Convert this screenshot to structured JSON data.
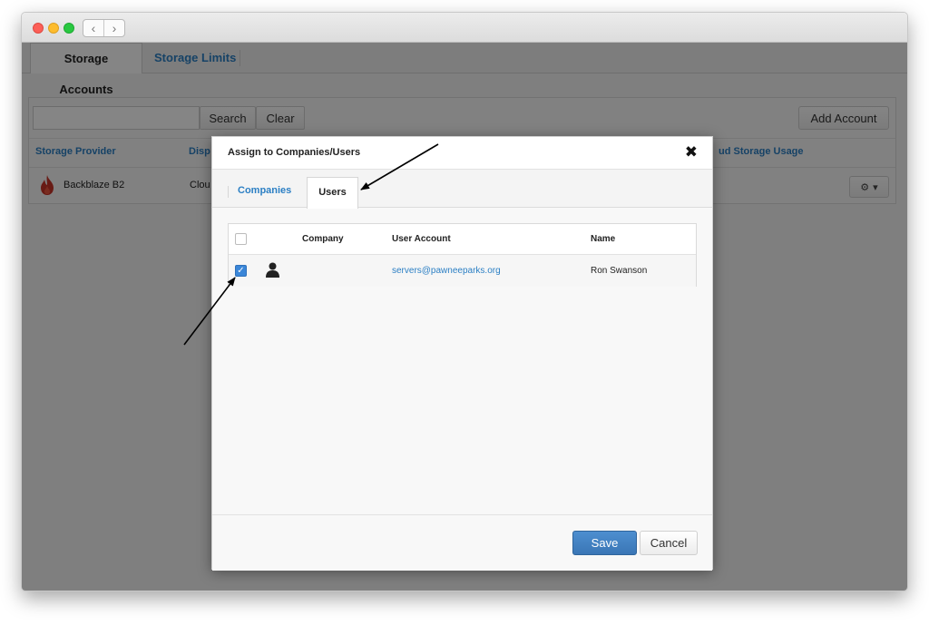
{
  "main_tabs": [
    {
      "label": "Storage Accounts"
    },
    {
      "label": "Storage Limits"
    }
  ],
  "toolbar": {
    "search_value": "",
    "search_label": "Search",
    "clear_label": "Clear",
    "add_account_label": "Add Account"
  },
  "table": {
    "columns": [
      "Storage Provider",
      "Disp",
      "ud Storage Usage"
    ],
    "rows": [
      {
        "provider": "Backblaze B2",
        "display": "Clou"
      }
    ]
  },
  "modal": {
    "title": "Assign to Companies/Users",
    "close_glyph": "✖",
    "tabs": [
      {
        "label": "Companies"
      },
      {
        "label": "Users"
      }
    ],
    "columns": [
      "Company",
      "User Account",
      "Name"
    ],
    "rows": [
      {
        "checked": true,
        "icon": "user-icon",
        "company": "",
        "user_account": "servers@pawneeparks.org",
        "name": "Ron Swanson"
      }
    ],
    "save_label": "Save",
    "cancel_label": "Cancel"
  },
  "colors": {
    "accent": "#2b7fc4",
    "primary_button": "#3a76b5",
    "checkbox_checked": "#3a86d8",
    "provider_logo": "#c8342a"
  }
}
